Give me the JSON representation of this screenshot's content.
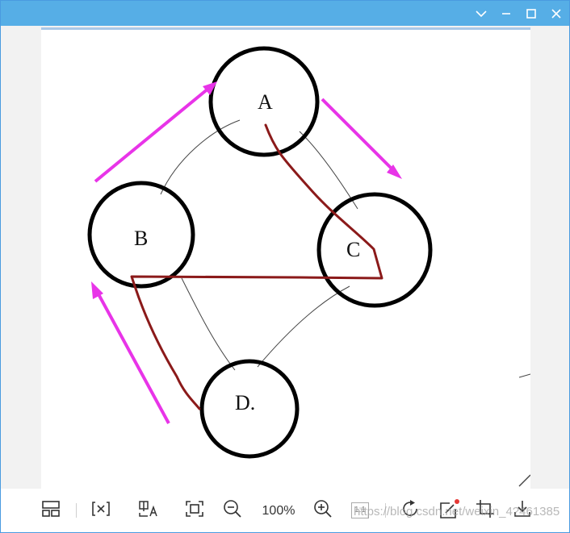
{
  "toolbar": {
    "zoom_level": "100%",
    "actual_size_label": "1:1"
  },
  "image": {
    "nodes": {
      "a": "A",
      "b": "B",
      "c": "C",
      "d": "D."
    }
  },
  "watermark": "https://blog.csdn.net/weixin_4?461385",
  "colors": {
    "titlebar": "#56aee6",
    "arrow": "#e834e8",
    "path": "#8b1a1a"
  }
}
